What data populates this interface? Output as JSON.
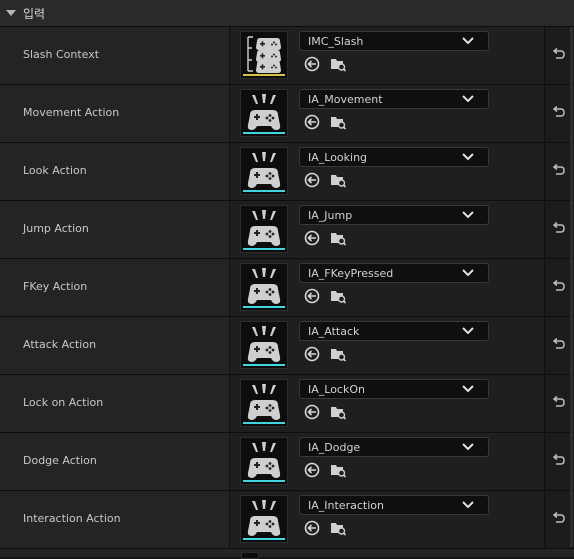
{
  "section": {
    "title": "입력"
  },
  "rows": [
    {
      "label": "Slash Context",
      "value": "IMC_Slash",
      "kind": "context"
    },
    {
      "label": "Movement Action",
      "value": "IA_Movement",
      "kind": "action"
    },
    {
      "label": "Look Action",
      "value": "IA_Looking",
      "kind": "action"
    },
    {
      "label": "Jump Action",
      "value": "IA_Jump",
      "kind": "action"
    },
    {
      "label": "FKey Action",
      "value": "IA_FKeyPressed",
      "kind": "action"
    },
    {
      "label": "Attack Action",
      "value": "IA_Attack",
      "kind": "action"
    },
    {
      "label": "Lock on Action",
      "value": "IA_LockOn",
      "kind": "action"
    },
    {
      "label": "Dodge Action",
      "value": "IA_Dodge",
      "kind": "action"
    },
    {
      "label": "Interaction Action",
      "value": "IA_Interaction",
      "kind": "action"
    }
  ],
  "colors": {
    "context_bar": "#d9c24a",
    "action_bar": "#3fd6e0"
  },
  "icons": {
    "section_toggle": "caret-down-icon",
    "dropdown": "chevron-down-icon",
    "use_selected": "use-selected-arrow-icon",
    "browse": "browse-folder-icon",
    "reset": "reset-to-default-icon"
  }
}
